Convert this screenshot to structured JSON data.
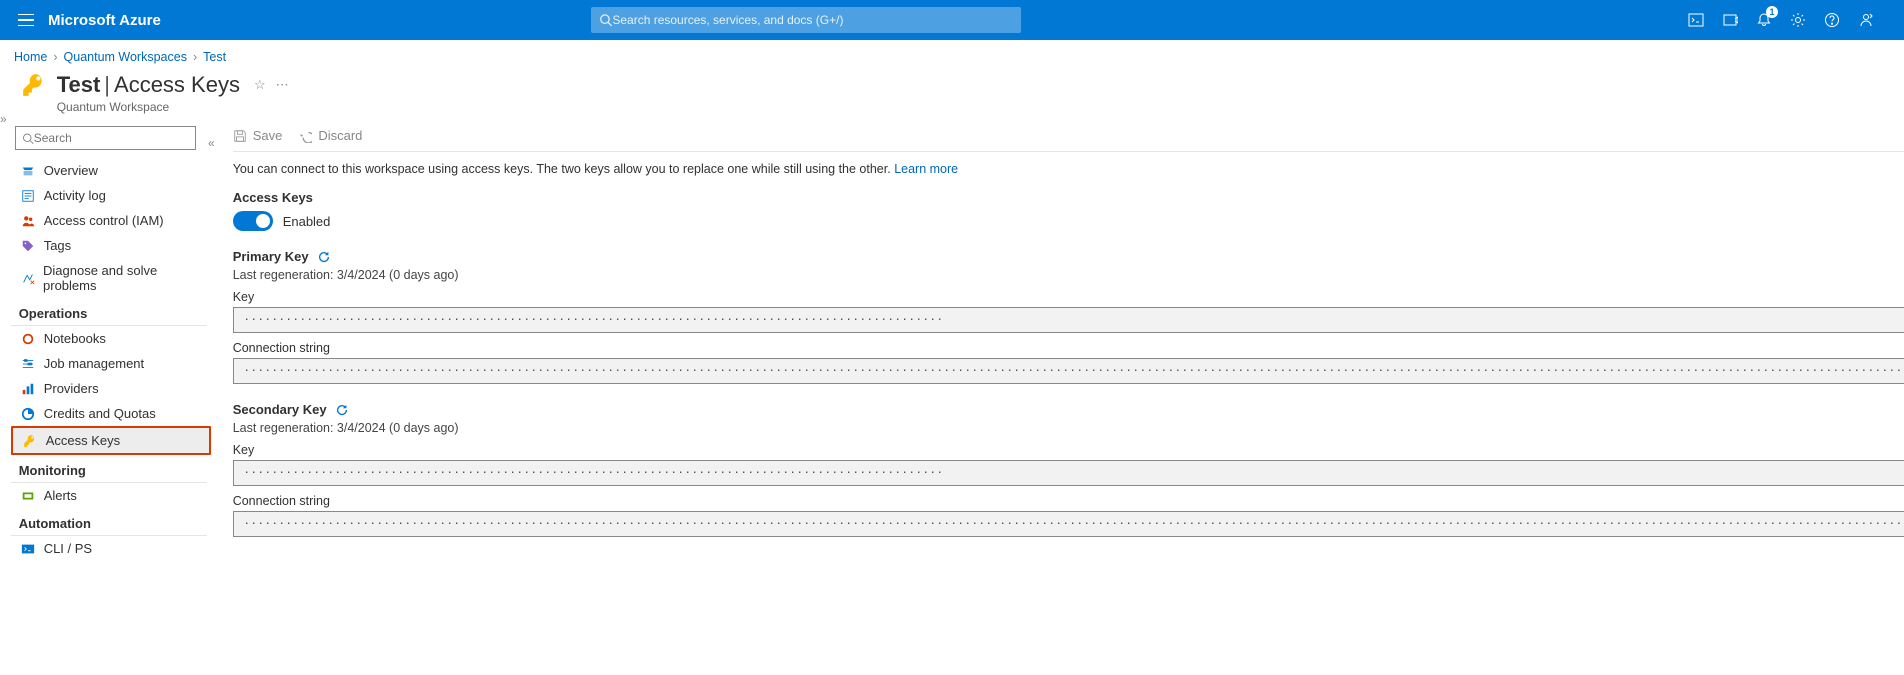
{
  "header": {
    "brand": "Microsoft Azure",
    "search_placeholder": "Search resources, services, and docs (G+/)",
    "notification_count": "1"
  },
  "breadcrumb": {
    "items": [
      "Home",
      "Quantum Workspaces",
      "Test"
    ]
  },
  "title": {
    "resource": "Test",
    "section": "Access Keys",
    "subtitle": "Quantum Workspace"
  },
  "nav": {
    "search_placeholder": "Search",
    "items_general": [
      {
        "label": "Overview"
      },
      {
        "label": "Activity log"
      },
      {
        "label": "Access control (IAM)"
      },
      {
        "label": "Tags"
      },
      {
        "label": "Diagnose and solve problems"
      }
    ],
    "section_ops": "Operations",
    "items_ops": [
      {
        "label": "Notebooks"
      },
      {
        "label": "Job management"
      },
      {
        "label": "Providers"
      },
      {
        "label": "Credits and Quotas"
      },
      {
        "label": "Access Keys"
      }
    ],
    "section_mon": "Monitoring",
    "items_mon": [
      {
        "label": "Alerts"
      }
    ],
    "section_auto": "Automation",
    "items_auto": [
      {
        "label": "CLI / PS"
      }
    ]
  },
  "commands": {
    "save": "Save",
    "discard": "Discard"
  },
  "content": {
    "description": "You can connect to this workspace using access keys. The two keys allow you to replace one while still using the other.",
    "learn_more": "Learn more",
    "access_keys_label": "Access Keys",
    "toggle_state": "Enabled",
    "primary": {
      "title": "Primary Key",
      "regen": "Last regeneration: 3/4/2024 (0 days ago)",
      "key_label": "Key",
      "key_mask": "····································································································",
      "conn_label": "Connection string",
      "conn_mask": "·········································································································································································································································································································"
    },
    "secondary": {
      "title": "Secondary Key",
      "regen": "Last regeneration: 3/4/2024 (0 days ago)",
      "key_label": "Key",
      "key_mask": "····································································································",
      "conn_label": "Connection string",
      "conn_mask": "·········································································································································································································································································································"
    }
  }
}
